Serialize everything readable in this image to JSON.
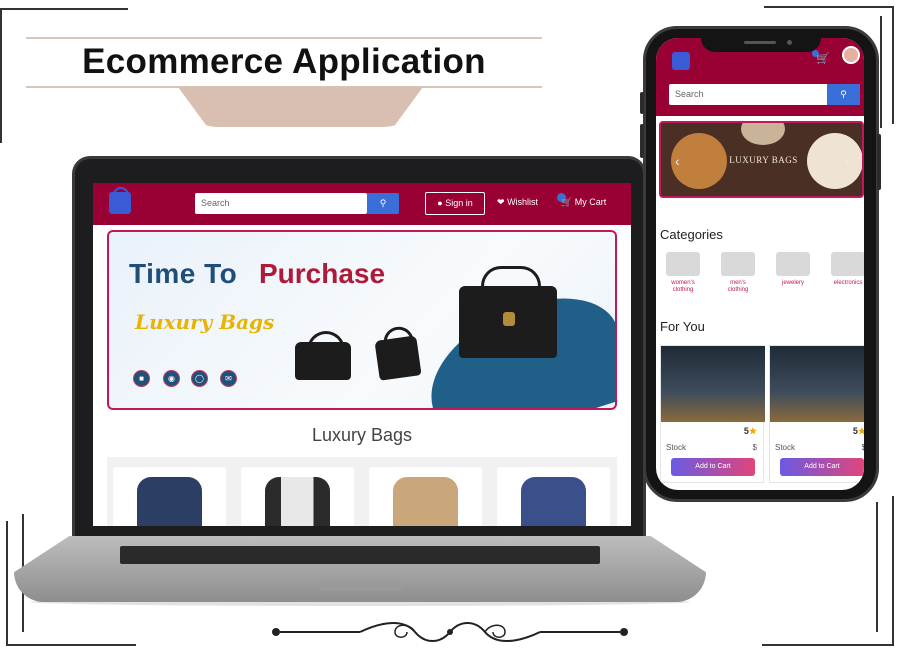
{
  "title": "Ecommerce Application",
  "laptop": {
    "nav": {
      "search_placeholder": "Search",
      "search_icon": "search-icon",
      "signin_label": "Sign in",
      "wishlist_label": "Wishlist",
      "cart_label": "My Cart"
    },
    "banner": {
      "headline_part1": "Time To",
      "headline_part2": "Purchase",
      "subline": "Luxury Bags",
      "social_icons": [
        "bus-icon",
        "location-icon",
        "globe-icon",
        "mail-icon"
      ]
    },
    "section_title": "Luxury Bags",
    "products": [
      {
        "name": "navy-bag",
        "color": "#2c3e63"
      },
      {
        "name": "raglan-shirt",
        "color": "#2b2b2b"
      },
      {
        "name": "beige-jacket",
        "color": "#c9a77a"
      },
      {
        "name": "blue-sweater",
        "color": "#3b4f8a"
      }
    ]
  },
  "phone": {
    "search_placeholder": "Search",
    "banner_text": "LUXURY BAGS",
    "categories_title": "Categories",
    "categories": [
      "women's clothing",
      "men's clothing",
      "jewelery",
      "electronics"
    ],
    "for_you_title": "For You",
    "cards": [
      {
        "rating": "5",
        "stock_label": "Stock",
        "price": "$",
        "button": "Add to Cart"
      },
      {
        "rating": "5",
        "stock_label": "Stock",
        "price": "$",
        "button": "Add to Cart"
      }
    ]
  },
  "colors": {
    "brand": "#990033",
    "accent": "#3a6fd8",
    "button_gradient_start": "#6a5be2",
    "button_gradient_end": "#e0457b"
  }
}
